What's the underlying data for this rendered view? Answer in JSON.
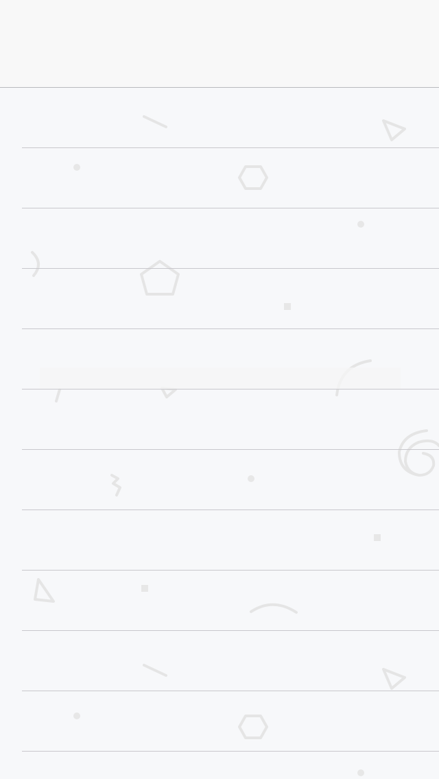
{
  "nav": {
    "title": ""
  },
  "list": {
    "rows": [
      "",
      "",
      "",
      "",
      "",
      "",
      "",
      "",
      "",
      "",
      "",
      "",
      ""
    ]
  },
  "colors": {
    "background": "#f7f8fa",
    "nav_background": "#f8f8f8",
    "separator": "#c8c7cc",
    "pattern": "#e7e7e7"
  }
}
